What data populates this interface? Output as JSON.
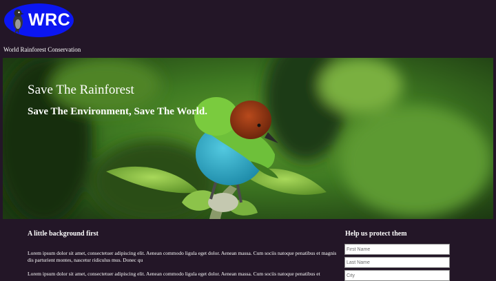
{
  "logo": {
    "text": "WRC"
  },
  "org_name": "World Rainforest Conservation",
  "hero": {
    "title": "Save The Rainforest",
    "subtitle": "Save The Environment, Save The World."
  },
  "background": {
    "heading": "A little background first",
    "paragraph1": "Lorem ipsum dolor sit amet, consectetuer adipiscing elit. Aenean commodo ligula eget dolor. Aenean massa. Cum sociis natoque penatibus et magnis dis parturient montes, nascetur ridiculus mus. Donec qu",
    "paragraph2": "Lorem ipsum dolor sit amet, consectetuer adipiscing elit. Aenean commodo ligula eget dolor. Aenean massa. Cum sociis natoque penatibus et"
  },
  "form": {
    "heading": "Help us protect them",
    "first_name_placeholder": "First Name",
    "last_name_placeholder": "Last Name",
    "city_placeholder": "City"
  }
}
